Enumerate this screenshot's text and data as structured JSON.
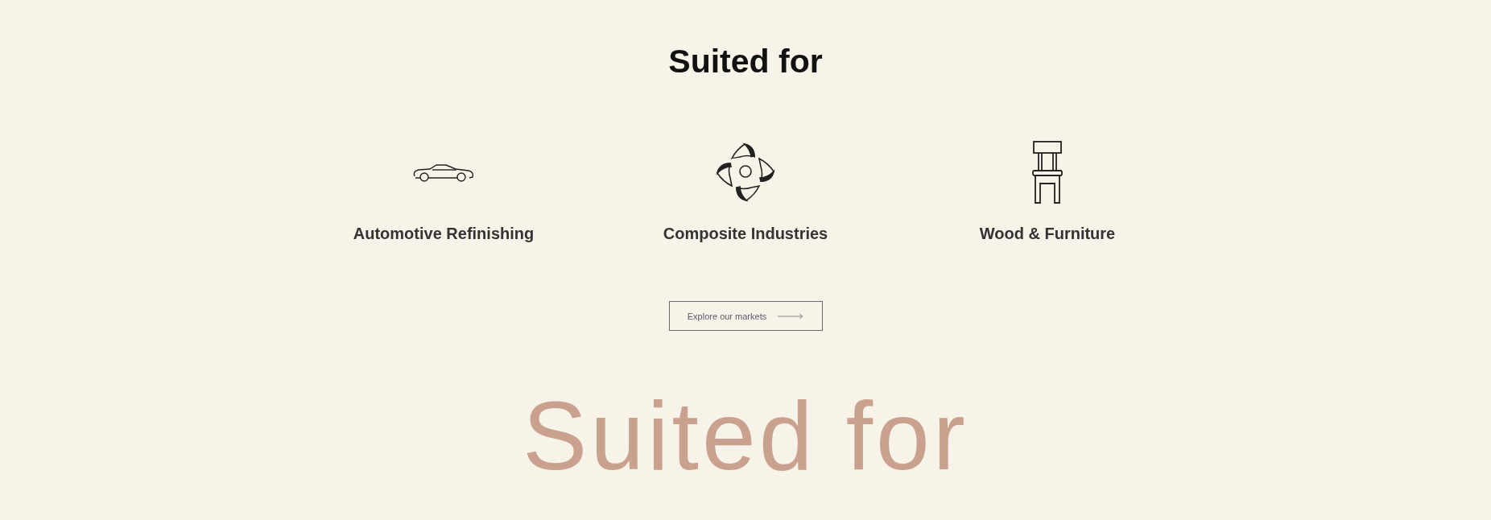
{
  "heading": "Suited for",
  "markets": [
    {
      "kind": "car",
      "label": "Automotive Refinishing"
    },
    {
      "kind": "disc",
      "label": "Composite Industries"
    },
    {
      "kind": "chair",
      "label": "Wood & Furniture"
    }
  ],
  "button": {
    "label": "Explore our markets"
  },
  "background_text": "Suited for"
}
